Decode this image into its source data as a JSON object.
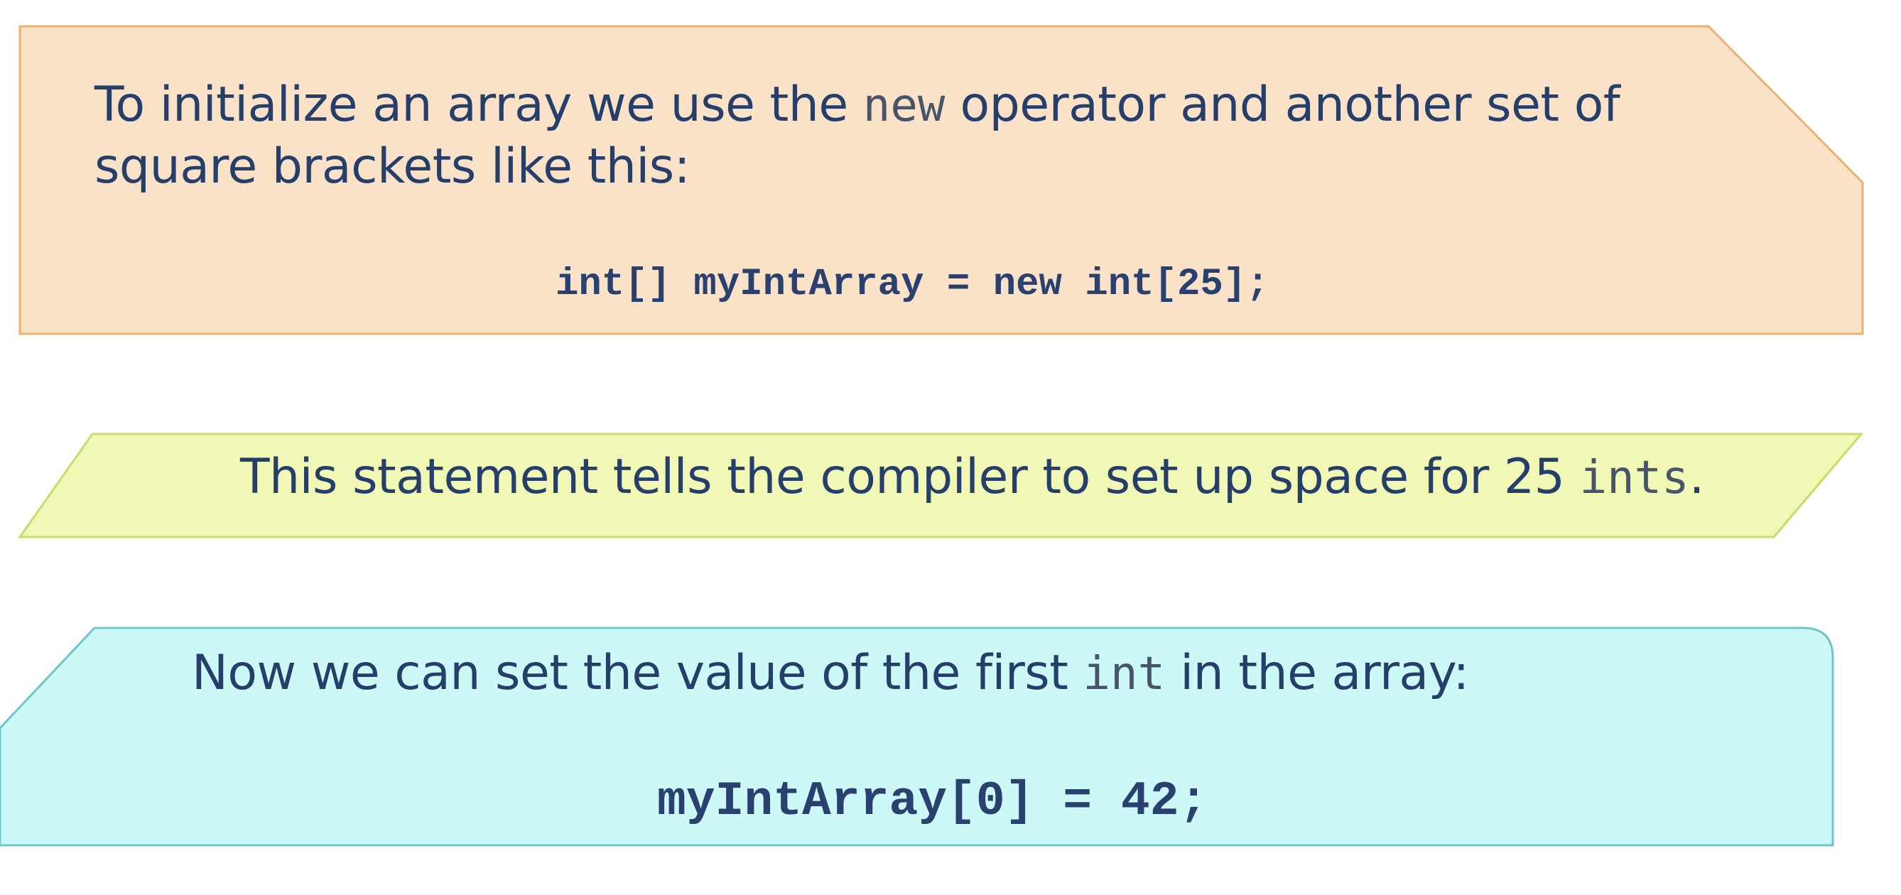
{
  "colors": {
    "panel1_fill": "#f9e2c7",
    "panel1_stroke": "#e9b26f",
    "panel2_fill": "#f1f8b5",
    "panel2_stroke": "#c6dc6b",
    "panel3_fill": "#cdf8f8",
    "panel3_stroke": "#6fc6c8",
    "text": "#263f6a"
  },
  "panel1": {
    "line1_before": "To initialize an array we use the ",
    "line1_code": "new",
    "line1_after": " operator and another set of",
    "line2": "square brackets like this:",
    "code": "int[] myIntArray = new int[25];"
  },
  "panel2": {
    "text_before": "This statement tells the compiler to set up space for 25 ",
    "text_code": "ints",
    "text_after": "."
  },
  "panel3": {
    "text_before": "Now we can set the value of the first ",
    "text_code": "int",
    "text_after": " in the array:",
    "code": "myIntArray[0] = 42;"
  }
}
